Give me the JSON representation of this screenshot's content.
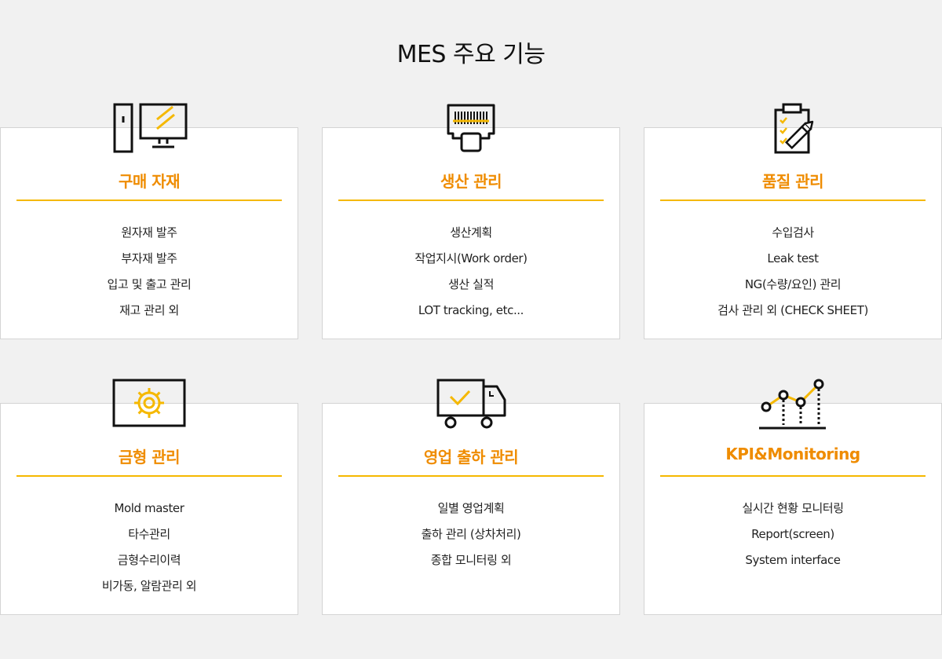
{
  "title": "MES 주요 기능",
  "cards": [
    {
      "icon": "computer-icon",
      "title": "구매 자재",
      "items": [
        "원자재 발주",
        "부자재 발주",
        "입고 및 출고 관리",
        "재고 관리 외"
      ]
    },
    {
      "icon": "barcode-scanner-icon",
      "title": "생산 관리",
      "items": [
        "생산계획",
        "작업지시(Work order)",
        "생산 실적",
        "LOT tracking,  etc..."
      ]
    },
    {
      "icon": "clipboard-checklist-icon",
      "title": "품질 관리",
      "items": [
        "수입검사",
        "Leak test",
        "NG(수량/요인) 관리",
        "검사 관리 외 (CHECK SHEET)"
      ]
    },
    {
      "icon": "gear-icon",
      "title": "금형 관리",
      "items": [
        "Mold master",
        "타수관리",
        "금형수리이력",
        "비가동, 알람관리 외"
      ]
    },
    {
      "icon": "delivery-truck-icon",
      "title": "영업 출하 관리",
      "items": [
        "일별 영업계획",
        "출하 관리 (상차처리)",
        "종합 모니터링 외"
      ]
    },
    {
      "icon": "line-chart-icon",
      "title": "KPI&Monitoring",
      "items": [
        "실시간 현황 모니터링",
        "Report(screen)",
        "System interface"
      ]
    }
  ],
  "colors": {
    "accent": "#ef8c00",
    "divider": "#f5b800",
    "icon_line": "#111111",
    "icon_accent": "#f5b800",
    "background": "#f1f1f1",
    "card": "#ffffff"
  }
}
